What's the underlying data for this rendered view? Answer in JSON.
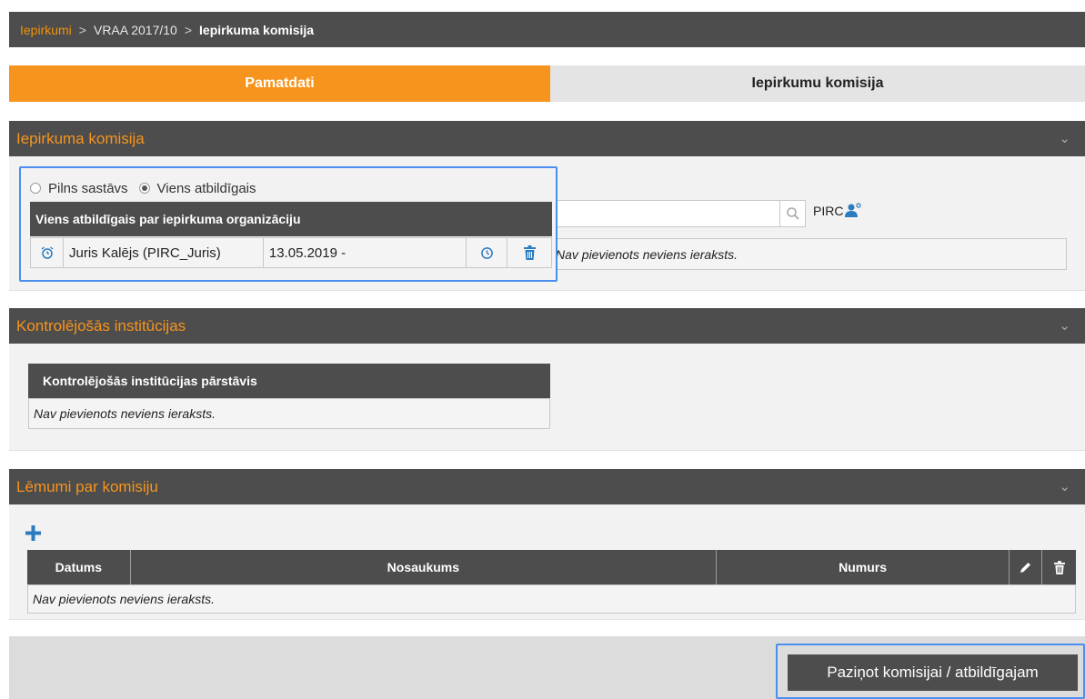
{
  "breadcrumb": {
    "link": "Iepirkumi",
    "separator": ">",
    "item2": "VRAA 2017/10",
    "current": "Iepirkuma komisija"
  },
  "tabs": {
    "active": "Pamatdati",
    "inactive": "Iepirkumu komisija"
  },
  "section1": {
    "title": "Iepirkuma komisija",
    "radio_full": "Pilns sastāvs",
    "radio_single": "Viens atbildīgais",
    "table_header": "Viens atbildīgais par iepirkuma organizāciju",
    "person_name": "Juris Kalējs (PIRC_Juris)",
    "person_date": "13.05.2019 -",
    "search_suffix": "PIRC",
    "empty_text": "Nav pievienots neviens ieraksts."
  },
  "section2": {
    "title": "Kontrolējošās institūcijas",
    "table_header": "Kontrolējošās institūcijas pārstāvis",
    "empty_text": "Nav pievienots neviens ieraksts."
  },
  "section3": {
    "title": "Lēmumi par komisiju",
    "columns": {
      "date": "Datums",
      "name": "Nosaukums",
      "number": "Numurs"
    },
    "empty_text": "Nav pievienots neviens ieraksts."
  },
  "footer": {
    "notify_button": "Paziņot komisijai / atbildīgajam"
  },
  "colors": {
    "accent": "#f7941d",
    "dark": "#4d4d4d",
    "focus": "#4a8ff0",
    "icon_blue": "#2b7bbf"
  }
}
